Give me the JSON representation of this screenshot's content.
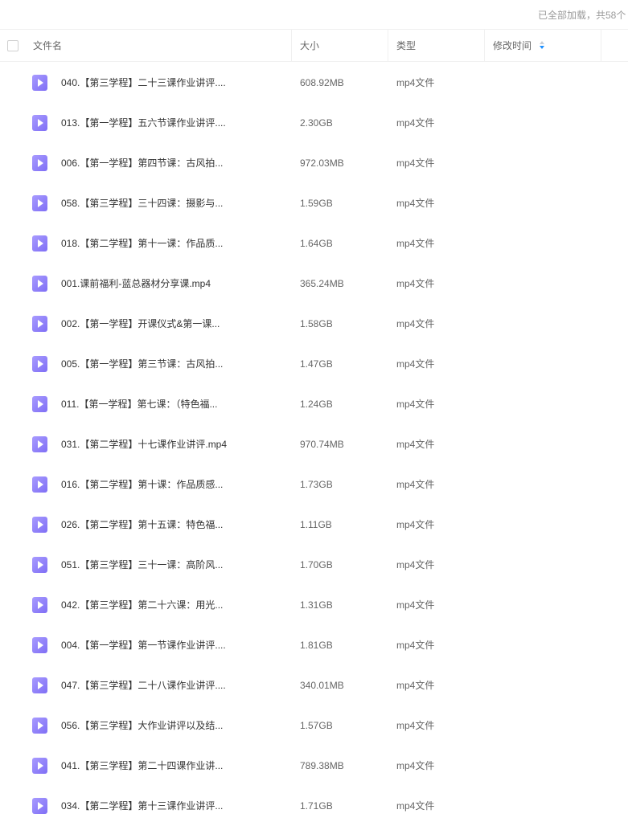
{
  "status": {
    "text": "已全部加载，共58个"
  },
  "header": {
    "name_label": "文件名",
    "size_label": "大小",
    "type_label": "类型",
    "time_label": "修改时间"
  },
  "files": [
    {
      "name": "040.【第三学程】二十三课作业讲评....",
      "size": "608.92MB",
      "type": "mp4文件",
      "modified": ""
    },
    {
      "name": "013.【第一学程】五六节课作业讲评....",
      "size": "2.30GB",
      "type": "mp4文件",
      "modified": ""
    },
    {
      "name": "006.【第一学程】第四节课：古风拍...",
      "size": "972.03MB",
      "type": "mp4文件",
      "modified": ""
    },
    {
      "name": "058.【第三学程】三十四课：摄影与...",
      "size": "1.59GB",
      "type": "mp4文件",
      "modified": ""
    },
    {
      "name": "018.【第二学程】第十一课：作品质...",
      "size": "1.64GB",
      "type": "mp4文件",
      "modified": ""
    },
    {
      "name": "001.课前福利-蓝总器材分享课.mp4",
      "size": "365.24MB",
      "type": "mp4文件",
      "modified": ""
    },
    {
      "name": "002.【第一学程】开课仪式&第一课...",
      "size": "1.58GB",
      "type": "mp4文件",
      "modified": ""
    },
    {
      "name": "005.【第一学程】第三节课：古风拍...",
      "size": "1.47GB",
      "type": "mp4文件",
      "modified": ""
    },
    {
      "name": "011.【第一学程】第七课：（特色福...",
      "size": "1.24GB",
      "type": "mp4文件",
      "modified": ""
    },
    {
      "name": "031.【第二学程】十七课作业讲评.mp4",
      "size": "970.74MB",
      "type": "mp4文件",
      "modified": ""
    },
    {
      "name": "016.【第二学程】第十课：作品质感...",
      "size": "1.73GB",
      "type": "mp4文件",
      "modified": ""
    },
    {
      "name": "026.【第二学程】第十五课：特色福...",
      "size": "1.11GB",
      "type": "mp4文件",
      "modified": ""
    },
    {
      "name": "051.【第三学程】三十一课：高阶风...",
      "size": "1.70GB",
      "type": "mp4文件",
      "modified": ""
    },
    {
      "name": "042.【第三学程】第二十六课：用光...",
      "size": "1.31GB",
      "type": "mp4文件",
      "modified": ""
    },
    {
      "name": "004.【第一学程】第一节课作业讲评....",
      "size": "1.81GB",
      "type": "mp4文件",
      "modified": ""
    },
    {
      "name": "047.【第三学程】二十八课作业讲评....",
      "size": "340.01MB",
      "type": "mp4文件",
      "modified": ""
    },
    {
      "name": "056.【第三学程】大作业讲评以及结...",
      "size": "1.57GB",
      "type": "mp4文件",
      "modified": ""
    },
    {
      "name": "041.【第三学程】第二十四课作业讲...",
      "size": "789.38MB",
      "type": "mp4文件",
      "modified": ""
    },
    {
      "name": "034.【第二学程】第十三课作业讲评...",
      "size": "1.71GB",
      "type": "mp4文件",
      "modified": ""
    }
  ]
}
